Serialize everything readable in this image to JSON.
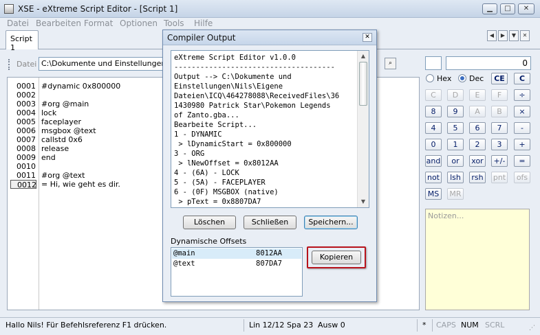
{
  "window": {
    "title": "XSE - eXtreme Script Editor - [Script 1]"
  },
  "menu": [
    "Datei",
    "Bearbeiten",
    "Format",
    "Optionen",
    "Tools",
    "Hilfe"
  ],
  "tabs": [
    {
      "label": "Script 1"
    }
  ],
  "file_row": {
    "label": "Datei",
    "path": "C:\\Dokumente und Einstellungen\\Nils\\"
  },
  "editor": {
    "active_line": 11,
    "lines": [
      {
        "num": "0001",
        "text": "#dynamic 0x800000"
      },
      {
        "num": "0002",
        "text": ""
      },
      {
        "num": "0003",
        "text": "#org @main"
      },
      {
        "num": "0004",
        "text": "lock"
      },
      {
        "num": "0005",
        "text": "faceplayer"
      },
      {
        "num": "0006",
        "text": "msgbox @text"
      },
      {
        "num": "0007",
        "text": "callstd 0x6"
      },
      {
        "num": "0008",
        "text": "release"
      },
      {
        "num": "0009",
        "text": "end"
      },
      {
        "num": "0010",
        "text": ""
      },
      {
        "num": "0011",
        "text": "#org @text"
      },
      {
        "num": "0012",
        "text": "= Hi, wie geht es dir."
      }
    ]
  },
  "calculator": {
    "display": "0",
    "hex_label": "Hex",
    "dec_label": "Dec",
    "selected_base": "Dec",
    "buttons": [
      [
        "CE",
        "C"
      ],
      [
        "C",
        "D",
        "E",
        "F",
        "÷"
      ],
      [
        "8",
        "9",
        "A",
        "B",
        "×"
      ],
      [
        "4",
        "5",
        "6",
        "7",
        "-"
      ],
      [
        "0",
        "1",
        "2",
        "3",
        "+"
      ],
      [
        "and",
        "or",
        "xor",
        "+/-",
        "="
      ],
      [
        "not",
        "lsh",
        "rsh",
        "pnt",
        "ofs"
      ],
      [
        "MS",
        "MR"
      ]
    ],
    "notes_placeholder": "Notizen..."
  },
  "status": {
    "message": "Hallo Nils! Für Befehlsreferenz F1 drücken.",
    "line": "Lin 12/12",
    "col": "Spa 23",
    "sel": "Ausw 0",
    "modified": "*",
    "caps": "CAPS",
    "num": "NUM",
    "scrl": "SCRL"
  },
  "dialog": {
    "title": "Compiler Output",
    "output_lines": [
      "eXtreme Script Editor v1.0.0",
      "-------------------------------------",
      "Output --> C:\\Dokumente und",
      "Einstellungen\\Nils\\Eigene",
      "Dateien\\ICQ\\464278088\\ReceivedFiles\\36",
      "1430980 Patrick Star\\Pokemon Legends",
      "of Zanto.gba...",
      "Bearbeite Script...",
      "1 - DYNAMIC",
      " > lDynamicStart = 0x800000",
      "3 - ORG",
      " > lNewOffset = 0x8012AA",
      "4 - (6A) - LOCK",
      "5 - (5A) - FACEPLAYER",
      "6 - (0F) MSGBOX (native)",
      " > pText = 0x8807DA7"
    ],
    "buttons": {
      "clear": "Löschen",
      "close": "Schließen",
      "save": "Speichern..."
    },
    "offsets_label": "Dynamische Offsets",
    "offsets": [
      {
        "name": "@main",
        "value": "8012AA"
      },
      {
        "name": "@text",
        "value": "807DA7"
      }
    ],
    "copy_button": "Kopieren"
  }
}
